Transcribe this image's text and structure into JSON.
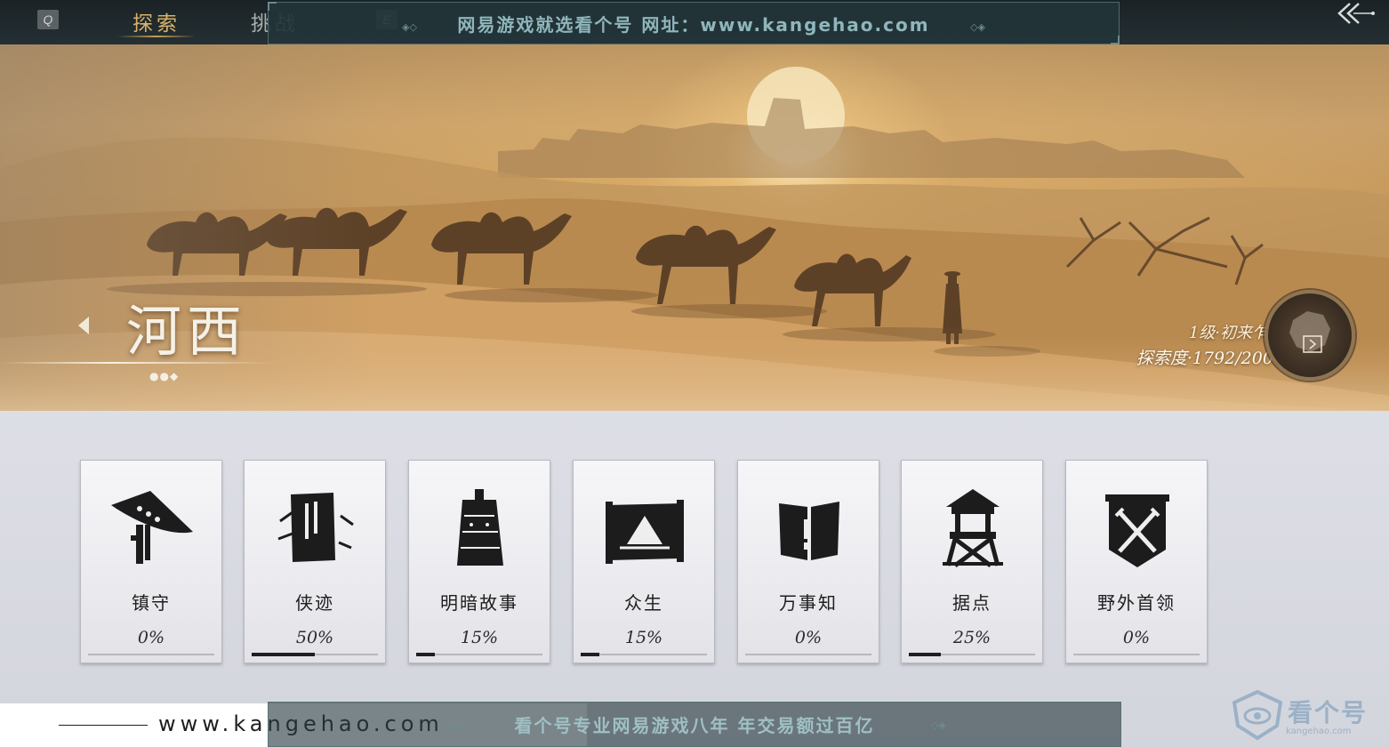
{
  "top_nav": {
    "key_left": "Q",
    "key_right": "E",
    "tab_explore": "探索",
    "tab_challenge": "挑战",
    "back_icon": "double-chevron-left-icon"
  },
  "watermark": {
    "top_banner": "网易游戏就选看个号   网址：www.kangehao.com",
    "bottom_url": "www.kangehao.com",
    "bottom_banner": "看个号专业网易游戏八年   年交易额过百亿",
    "logo_text": "看个号",
    "logo_url": "kangehao.com"
  },
  "region": {
    "name": "河西",
    "level": "1级·初来乍到",
    "progress_label": "探索度·1792/2000"
  },
  "categories": [
    {
      "label": "镇守",
      "percent_text": "0%",
      "progress": 0.0,
      "icon": "straw-hat-icon"
    },
    {
      "label": "侠迹",
      "percent_text": "50%",
      "progress": 0.5,
      "icon": "book-icon"
    },
    {
      "label": "明暗故事",
      "percent_text": "15%",
      "progress": 0.15,
      "icon": "bell-icon"
    },
    {
      "label": "众生",
      "percent_text": "15%",
      "progress": 0.15,
      "icon": "scroll-painting-icon"
    },
    {
      "label": "万事知",
      "percent_text": "0%",
      "progress": 0.0,
      "icon": "open-book-icon"
    },
    {
      "label": "据点",
      "percent_text": "25%",
      "progress": 0.25,
      "icon": "watchtower-icon"
    },
    {
      "label": "野外首领",
      "percent_text": "0%",
      "progress": 0.0,
      "icon": "crossed-swords-banner-icon"
    }
  ]
}
